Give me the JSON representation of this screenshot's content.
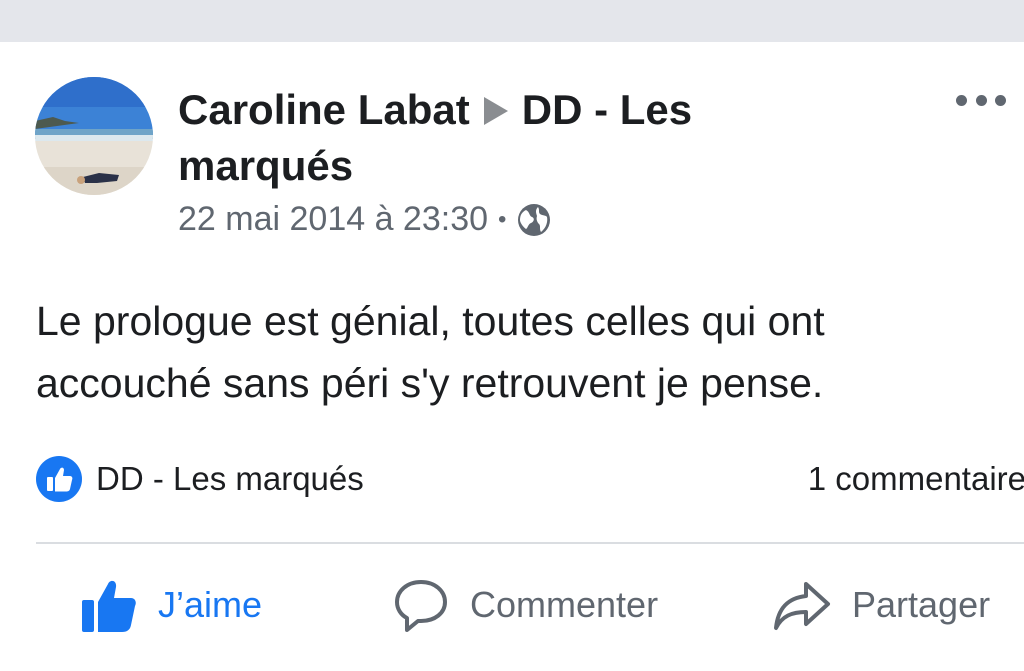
{
  "post": {
    "author": "Caroline Labat",
    "group": "DD - Les marqués",
    "timestamp": "22 mai 2014 à 23:30",
    "separator": "•",
    "privacy_icon": "globe-icon",
    "text": "Le prologue est génial, toutes celles qui ont accouché sans péri s'y retrouvent je pense.",
    "reactions": {
      "icon": "like-icon",
      "label": "DD - Les marqués"
    },
    "comments_count": "1 commentaire"
  },
  "actions": {
    "like": "J’aime",
    "comment": "Commenter",
    "share": "Partager"
  },
  "colors": {
    "accent": "#1877f2",
    "secondary_text": "#606770",
    "divider": "#dadde1",
    "background_strip": "#e4e6eb"
  }
}
